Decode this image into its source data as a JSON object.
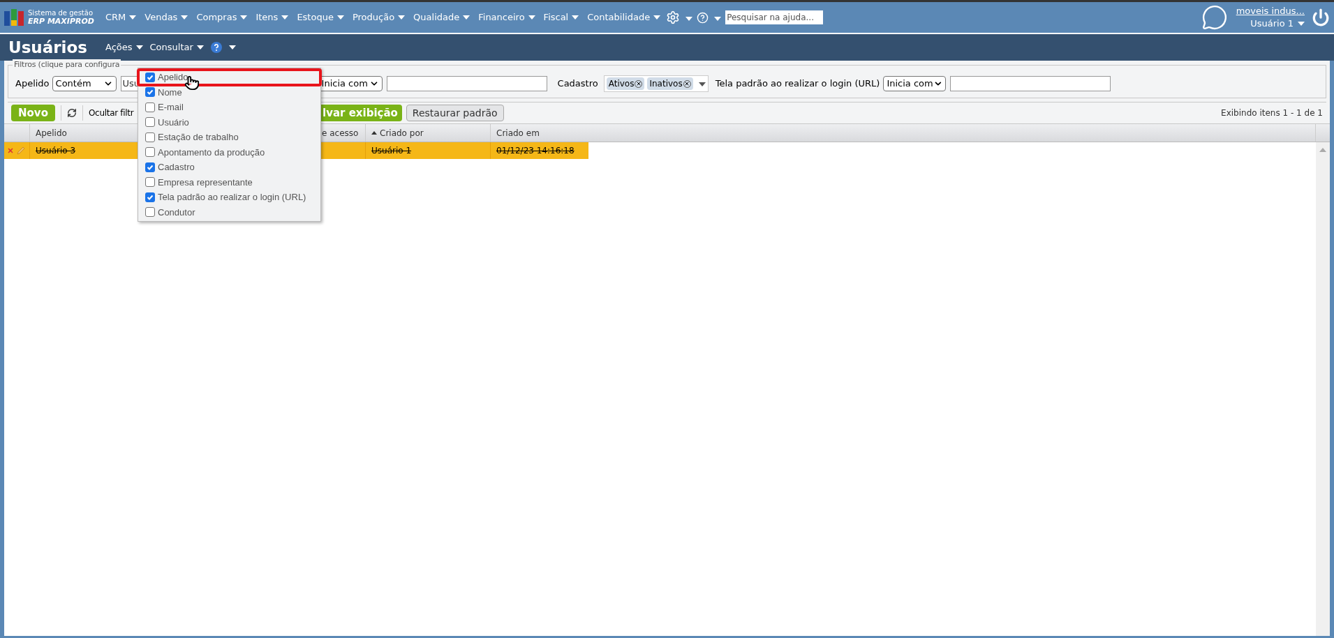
{
  "top_bar": {
    "logo": {
      "line1": "Sistema de gestão",
      "line2": "ERP MAXIPROD"
    },
    "menus": [
      "CRM",
      "Vendas",
      "Compras",
      "Itens",
      "Estoque",
      "Produção",
      "Qualidade",
      "Financeiro",
      "Fiscal",
      "Contabilidade"
    ],
    "search": {
      "placeholder": "Pesquisar na ajuda..."
    },
    "company": "moveis indus...",
    "user": "Usuário 1"
  },
  "page_header": {
    "title": "Usuários",
    "menus": [
      "Ações",
      "Consultar"
    ]
  },
  "filters": {
    "legend": "Filtros (clique para configura",
    "apelido": {
      "label": "Apelido",
      "operator": "Contém"
    },
    "hidden_field_value": "Usu",
    "second_operator": "Inicia com",
    "cadastro": {
      "label": "Cadastro",
      "chips": [
        "Ativos",
        "Inativos"
      ]
    },
    "url": {
      "label": "Tela padrão ao realizar o login (URL)",
      "operator": "Inicia com"
    }
  },
  "toolbar": {
    "new_button": "Novo",
    "hide_filters": "Ocultar filtr",
    "save_view": "lvar exibição",
    "restore": "Restaurar padrão",
    "count": "Exibindo itens 1 - 1 de 1"
  },
  "table": {
    "columns": [
      {
        "label": "Apelido",
        "sorted": false
      },
      {
        "label": "e acesso",
        "sorted": false
      },
      {
        "label": "Criado por",
        "sorted": true
      },
      {
        "label": "Criado em",
        "sorted": false
      }
    ],
    "rows": [
      {
        "apelido": "Usuário 3",
        "criado_por": "Usuário 1",
        "criado_em": "01/12/23 14:16:18",
        "inactive": true,
        "selected": true
      }
    ]
  },
  "column_menu": {
    "items": [
      {
        "label": "Apelido",
        "checked": true,
        "highlighted": true
      },
      {
        "label": "Nome",
        "checked": true,
        "highlighted": false
      },
      {
        "label": "E-mail",
        "checked": false,
        "highlighted": false
      },
      {
        "label": "Usuário",
        "checked": false,
        "highlighted": false
      },
      {
        "label": "Estação de trabalho",
        "checked": false,
        "highlighted": false
      },
      {
        "label": "Apontamento da produção",
        "checked": false,
        "highlighted": false
      },
      {
        "label": "Cadastro",
        "checked": true,
        "highlighted": false
      },
      {
        "label": "Empresa representante",
        "checked": false,
        "highlighted": false
      },
      {
        "label": "Tela padrão ao realizar o login (URL)",
        "checked": true,
        "highlighted": false
      },
      {
        "label": "Condutor",
        "checked": false,
        "highlighted": false
      }
    ]
  }
}
